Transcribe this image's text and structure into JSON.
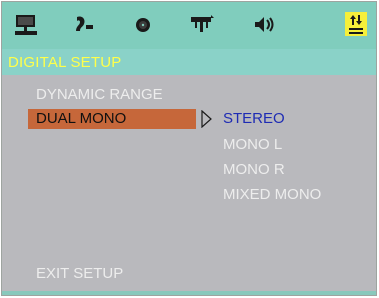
{
  "icons": [
    "monitor-icon",
    "audio-language-icon",
    "disc-icon",
    "video-connector-icon",
    "speaker-icon",
    "digital-setup-icon"
  ],
  "active_tab": "digital-setup-icon",
  "header": {
    "title": "DIGITAL SETUP"
  },
  "menu": {
    "items": [
      {
        "label": "DYNAMIC RANGE"
      },
      {
        "label": "DUAL MONO",
        "selected": true
      }
    ],
    "exit_label": "EXIT SETUP"
  },
  "submenu": {
    "options": [
      "STEREO",
      "MONO L",
      "MONO R",
      "MIXED MONO"
    ],
    "current": "STEREO"
  },
  "colors": {
    "osd_background": "#b9b9bd",
    "icon_bar": "#80cdbd",
    "title_bar": "#8ad2c8",
    "title_text": "#ffff4a",
    "highlight": "#c6673a",
    "current_option": "#1e2bb4",
    "active_tab": "#f6ef3a"
  }
}
